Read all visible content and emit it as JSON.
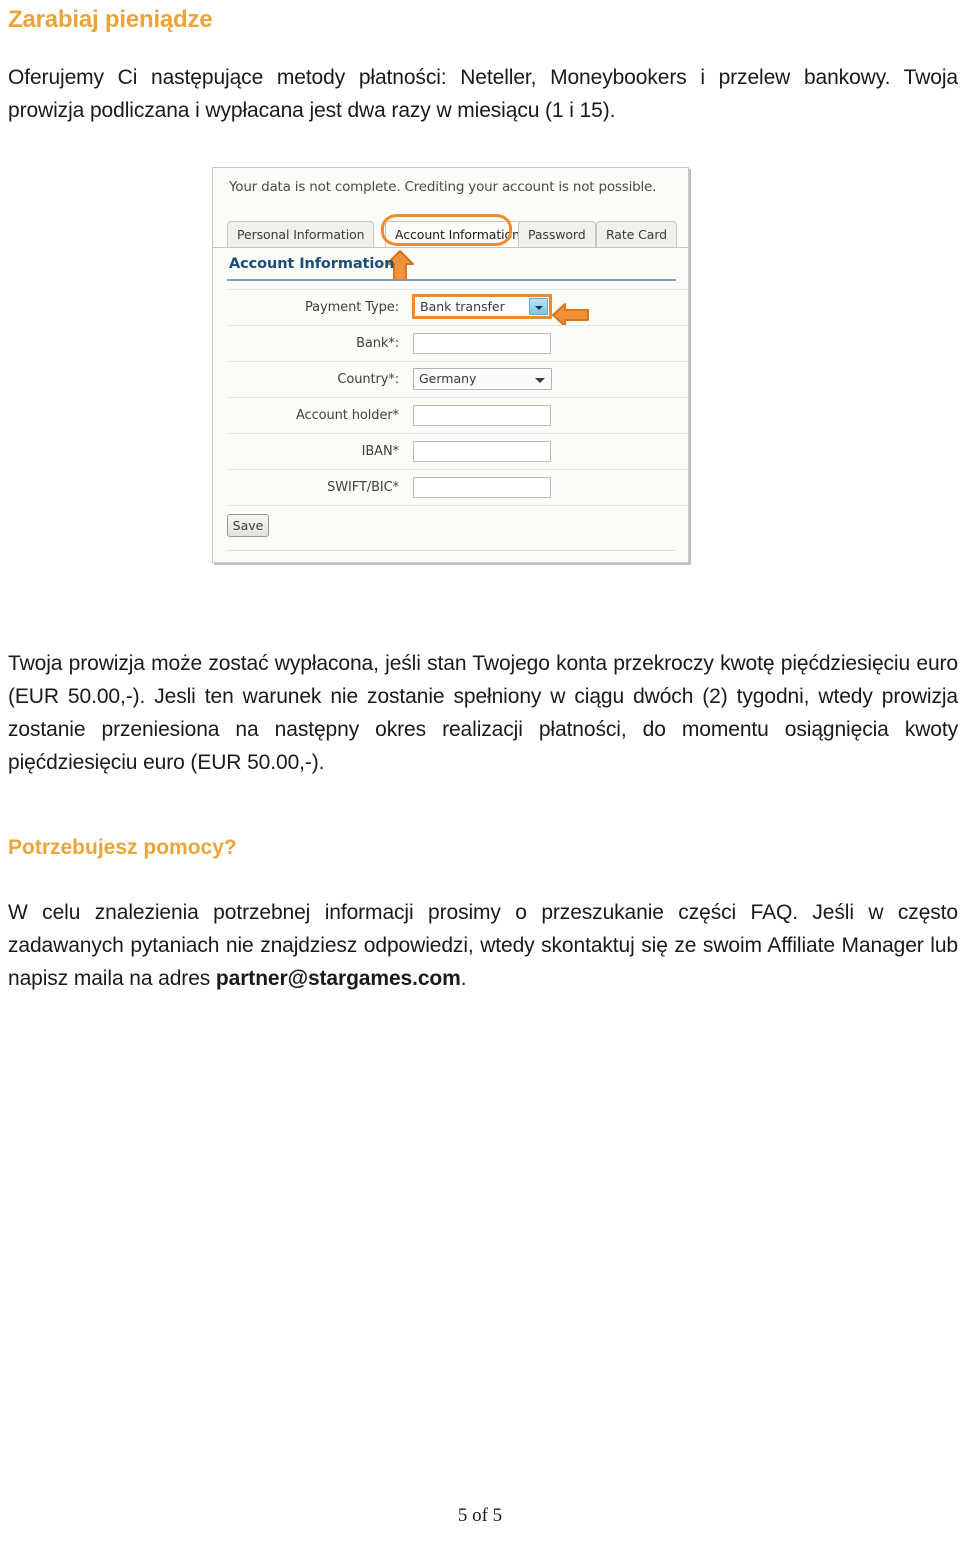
{
  "document": {
    "heading_1": "Zarabiaj pieniądze",
    "intro_paragraph": "Oferujemy Ci następujące metody płatności: Neteller, Moneybookers i przelew bankowy. Twoja prowizja podliczana i wypłacana jest dwa razy w miesiącu (1 i 15).",
    "middle_paragraph": "Twoja prowizja może zostać wypłacona, jeśli stan Twojego konta przekroczy kwotę pięćdziesięciu euro (EUR 50.00,-). Jesli ten warunek nie zostanie spełniony w ciągu dwóch (2) tygodni, wtedy prowizja zostanie przeniesiona na następny okres realizacji płatności, do momentu osiągnięcia kwoty pięćdziesięciu euro (EUR 50.00,-).",
    "heading_2": "Potrzebujesz pomocy?",
    "help_paragraph_part1": "W celu znalezienia potrzebnej informacji prosimy o przeszukanie części FAQ. Jeśli w często zadawanych pytaniach nie znajdziesz odpowiedzi, wtedy skontaktuj się ze swoim Affiliate Manager lub napisz maila na adres ",
    "help_email": "partner@stargames.com",
    "help_paragraph_part2": ".",
    "footer_page": "5 of 5",
    "heading_color": "#e9a43a"
  },
  "screenshot": {
    "notice": "Your data is not complete. Crediting your account is not possible.",
    "tabs": [
      {
        "label": "Personal Information",
        "active": false
      },
      {
        "label": "Account Information",
        "active": true
      },
      {
        "label": "Password",
        "active": false
      },
      {
        "label": "Rate Card",
        "active": false
      }
    ],
    "section_heading": "Account Information",
    "form": {
      "rows": [
        {
          "label": "Payment Type:",
          "type": "select",
          "value": "Bank transfer",
          "highlighted": true
        },
        {
          "label": "Bank*:",
          "type": "text",
          "value": ""
        },
        {
          "label": "Country*:",
          "type": "select",
          "value": "Germany",
          "highlighted": false
        },
        {
          "label": "Account holder*",
          "type": "text",
          "value": ""
        },
        {
          "label": "IBAN*",
          "type": "text",
          "value": ""
        },
        {
          "label": "SWIFT/BIC*",
          "type": "text",
          "value": ""
        }
      ],
      "save_label": "Save"
    },
    "annotation_color": "#ef8b2c",
    "section_heading_color": "#1c4d79"
  }
}
